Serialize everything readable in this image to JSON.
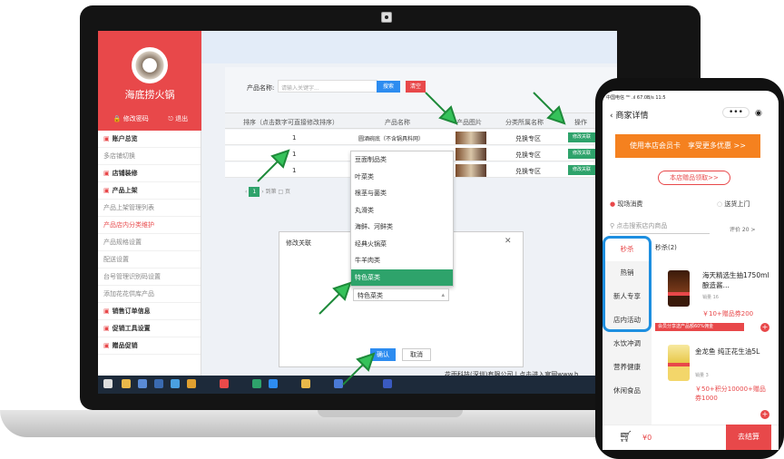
{
  "admin": {
    "brand": "海底捞火锅",
    "change_pwd": "修改密码",
    "logout": "退出",
    "menu": [
      {
        "label": "账户总览",
        "type": "head"
      },
      {
        "label": "多店铺切换",
        "type": "item"
      },
      {
        "label": "店铺装修",
        "type": "head"
      },
      {
        "label": "产品上架",
        "type": "head"
      },
      {
        "label": "产品上架管理列表",
        "type": "item"
      },
      {
        "label": "产品店内分类维护",
        "type": "active"
      },
      {
        "label": "产品规格设置",
        "type": "item"
      },
      {
        "label": "配送设置",
        "type": "item"
      },
      {
        "label": "台号管理识别码设置",
        "type": "item"
      },
      {
        "label": "添加花花供库产品",
        "type": "item"
      },
      {
        "label": "销售订单信息",
        "type": "head"
      },
      {
        "label": "促销工具设置",
        "type": "head"
      },
      {
        "label": "赠品促销",
        "type": "head"
      }
    ],
    "search_label": "产品名称:",
    "search_placeholder": "请输入关键字...",
    "search_btn": "搜索",
    "clear_btn": "清空",
    "columns": [
      "排序（点击数字可直接修改排序）",
      "产品名称",
      "产品图片",
      "分类所属名称",
      "操作"
    ],
    "rows": [
      {
        "sort": "1",
        "name": "圆酒碗底（不含锅具料网）",
        "category": "兑换专区",
        "action": "修改关联"
      },
      {
        "sort": "1",
        "name": "",
        "category": "兑换专区",
        "action": "修改关联"
      },
      {
        "sort": "1",
        "name": "",
        "category": "兑换专区",
        "action": "修改关联"
      }
    ],
    "pager": {
      "current": "1",
      "goto": "到第",
      "page": "页"
    },
    "dialog": {
      "title": "修改关联",
      "options": [
        "豆面制品类",
        "叶菜类",
        "根茎与菌类",
        "丸滑类",
        "海鲜、河鲜类",
        "经典火锅菜",
        "牛羊肉类",
        "特色菜类"
      ],
      "selected": "特色菜类",
      "ok": "确认",
      "cancel": "取消"
    },
    "footer": "花雨科技(深圳)有限公司 | 点击进入官网www.h"
  },
  "phone": {
    "status": "中国电信 ᴴᴰ .ıl 67.0B/s 11:5",
    "title": "商家详情",
    "banner": "使用本店会员卡　享受更多优惠 >>",
    "gift": "本店赠品领取>>",
    "dine_in": "现场消费",
    "delivery": "送货上门",
    "search_placeholder": "点击搜索店内商品",
    "rating": "评价 20 >",
    "categories": [
      "秒杀",
      "热销",
      "新人专享",
      "店内活动",
      "水饮冲调",
      "营养健康",
      "休闲食品"
    ],
    "section": "秒杀(2)",
    "products": [
      {
        "name": "海天精选生抽1750ml 酿造酱…",
        "sold": "销量 16",
        "price": "￥10+赠品券200"
      },
      {
        "name": "金龙鱼 纯正花生油5L",
        "sold": "销量 3",
        "price": "￥50+积分10000+赠品券1000"
      }
    ],
    "promo": "会员分享送产品额60%佣金",
    "cart_total": "¥0",
    "checkout": "去结算"
  }
}
